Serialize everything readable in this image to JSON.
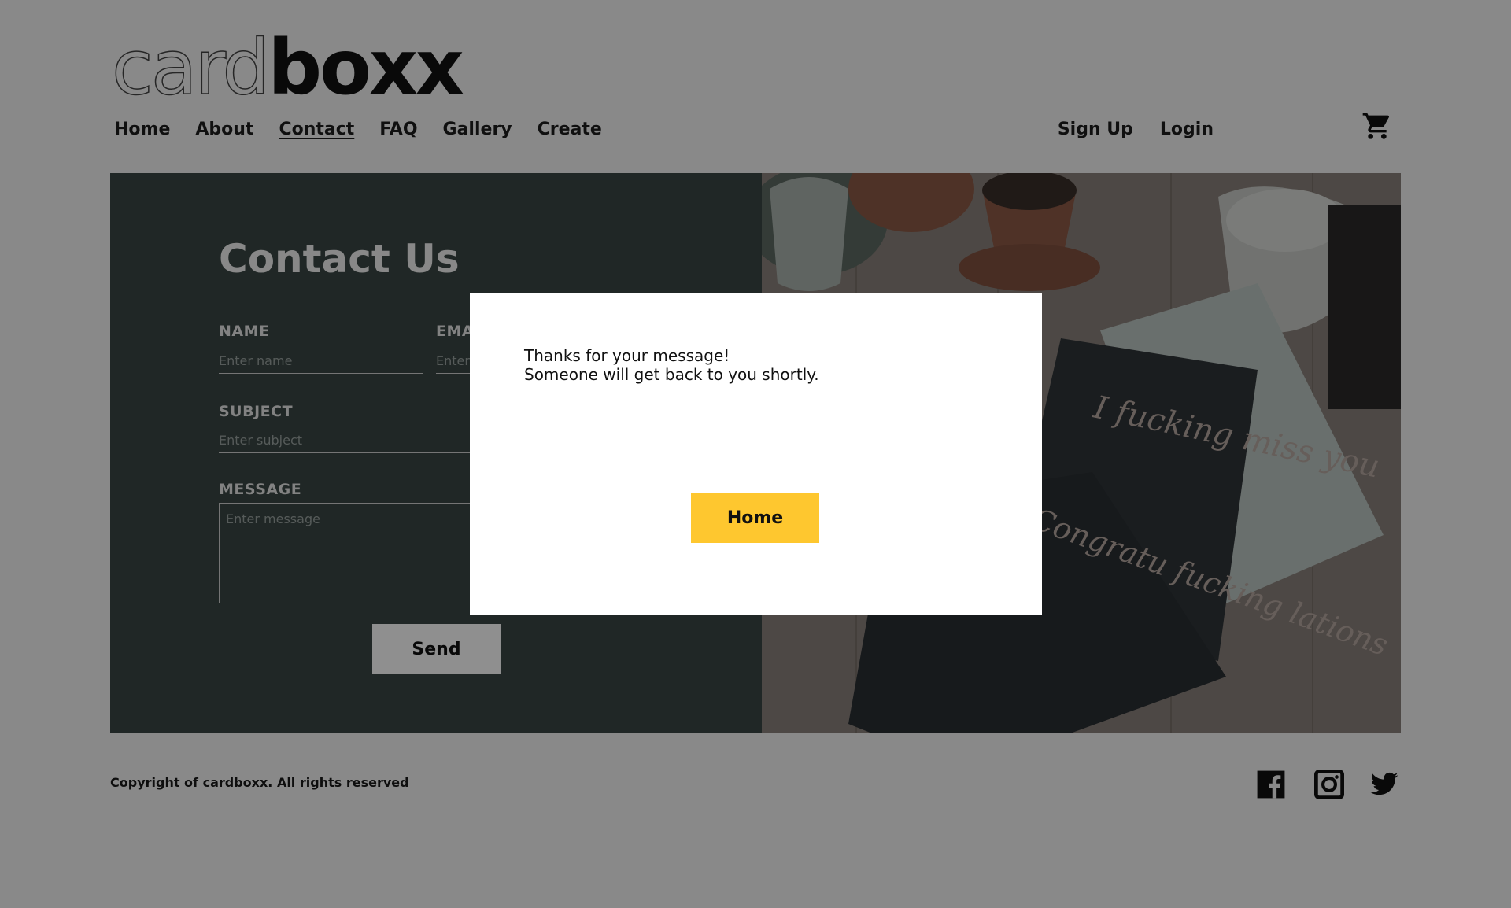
{
  "brand": {
    "light": "card",
    "bold": "boxx"
  },
  "nav": {
    "items": [
      {
        "label": "Home"
      },
      {
        "label": "About"
      },
      {
        "label": "Contact"
      },
      {
        "label": "FAQ"
      },
      {
        "label": "Gallery"
      },
      {
        "label": "Create"
      }
    ],
    "active": "Contact"
  },
  "auth": {
    "signup": "Sign Up",
    "login": "Login"
  },
  "icons": {
    "cart": "cart-icon",
    "facebook": "facebook-icon",
    "instagram": "instagram-icon",
    "twitter": "twitter-icon"
  },
  "contact": {
    "title": "Contact Us",
    "name_label": "NAME",
    "name_placeholder": "Enter name",
    "email_label": "EMAIL",
    "email_placeholder": "Enter email",
    "subject_label": "SUBJECT",
    "subject_placeholder": "Enter subject",
    "message_label": "MESSAGE",
    "message_placeholder": "Enter message",
    "send_label": "Send"
  },
  "photo": {
    "card1_text": "I fucking miss you",
    "card2_text": "Congratu fucking lations"
  },
  "modal": {
    "line1": "Thanks for your message!",
    "line2": "Someone will get back to you shortly.",
    "home_label": "Home"
  },
  "footer": {
    "copyright": "Copyright of cardboxx. All rights reserved"
  },
  "colors": {
    "accent": "#fec72f",
    "panel": "#3a4744",
    "overlay": "rgba(0,0,0,0.44)"
  }
}
